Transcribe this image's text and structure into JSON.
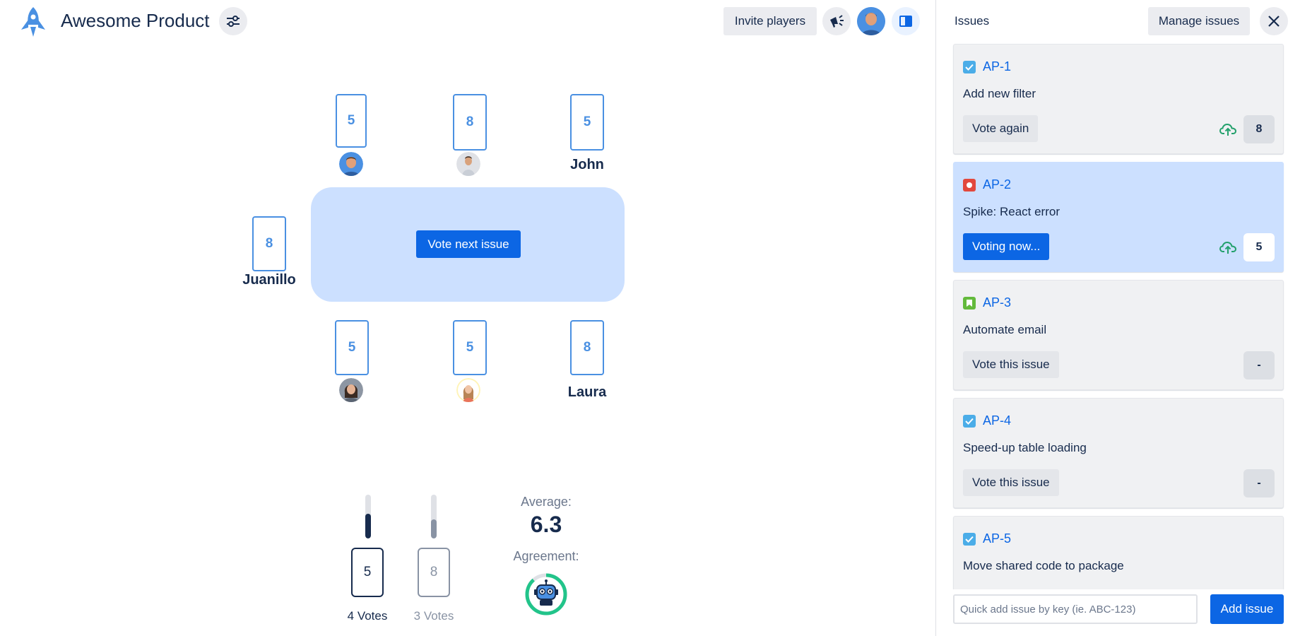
{
  "header": {
    "app_title": "Awesome Product",
    "invite_label": "Invite players",
    "accent": "#0c66e4"
  },
  "table": {
    "vote_next_label": "Vote next issue",
    "players": [
      {
        "card": "5",
        "name": "",
        "avatar": "man-blue-avatar"
      },
      {
        "card": "8",
        "name": "",
        "avatar": "man-grey-avatar"
      },
      {
        "card": "5",
        "name": "John",
        "avatar": ""
      },
      {
        "card": "8",
        "name": "Juanillo",
        "avatar": ""
      },
      {
        "card": "5",
        "name": "",
        "avatar": "woman-dark-avatar"
      },
      {
        "card": "5",
        "name": "",
        "avatar": "woman-yellow-avatar"
      },
      {
        "card": "8",
        "name": "Laura",
        "avatar": ""
      }
    ]
  },
  "summary": {
    "results": [
      {
        "card": "5",
        "votes_label": "4 Votes",
        "share": 0.57,
        "color": "#172b4d"
      },
      {
        "card": "8",
        "votes_label": "3 Votes",
        "share": 0.43,
        "color": "#8993a4"
      }
    ],
    "average_label": "Average:",
    "average_value": "6.3",
    "agreement_label": "Agreement:",
    "agreement_icon": "robot-icon"
  },
  "issues_panel": {
    "title": "Issues",
    "manage_label": "Manage issues",
    "issues": [
      {
        "key": "AP-1",
        "summary": "Add new filter",
        "type": "task",
        "action": "Vote again",
        "estimate": "8"
      },
      {
        "key": "AP-2",
        "summary": "Spike: React error",
        "type": "bug",
        "action": "Voting now...",
        "estimate": "5"
      },
      {
        "key": "AP-3",
        "summary": "Automate email",
        "type": "story",
        "action": "Vote this issue",
        "estimate": "-"
      },
      {
        "key": "AP-4",
        "summary": "Speed-up table loading",
        "type": "task",
        "action": "Vote this issue",
        "estimate": "-"
      },
      {
        "key": "AP-5",
        "summary": "Move shared code to package",
        "type": "task",
        "action": "",
        "estimate": ""
      }
    ],
    "quick_add_placeholder": "Quick add issue by key (ie. ABC-123)",
    "add_issue_label": "Add issue"
  }
}
